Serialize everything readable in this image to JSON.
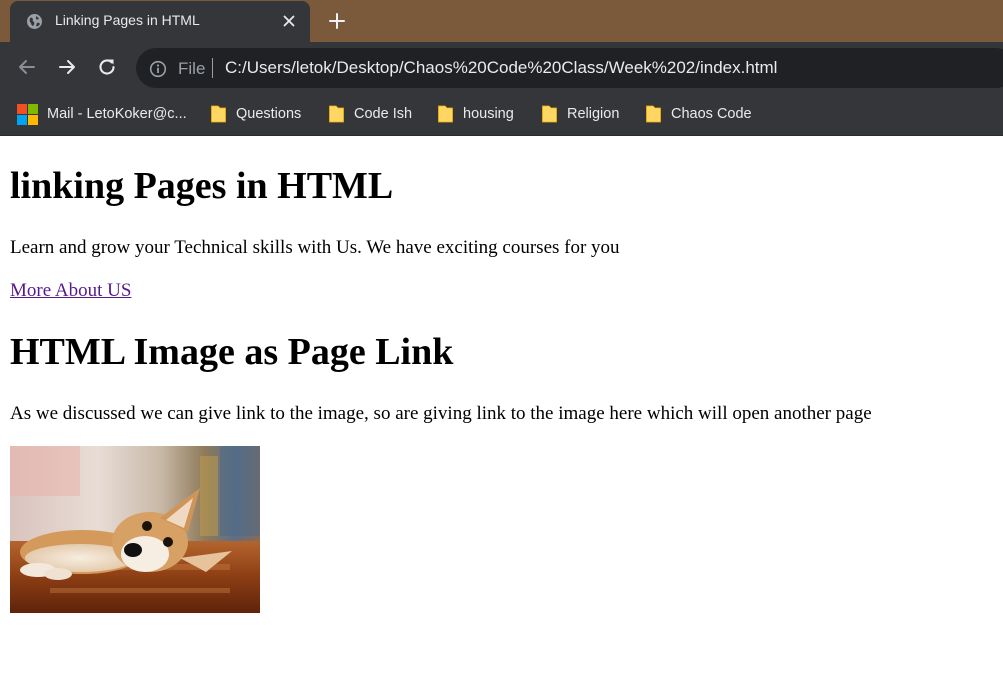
{
  "tab": {
    "title": "Linking Pages in HTML",
    "favicon": "globe-icon"
  },
  "toolbar": {
    "scheme": "File",
    "url": "C:/Users/letok/Desktop/Chaos%20Code%20Class/Week%202/index.html"
  },
  "bookmarks": [
    {
      "label": "Mail - LetoKoker@c...",
      "icon": "microsoft-icon"
    },
    {
      "label": "Questions",
      "icon": "folder-icon"
    },
    {
      "label": "Code Ish",
      "icon": "folder-icon"
    },
    {
      "label": "housing",
      "icon": "folder-icon"
    },
    {
      "label": "Religion",
      "icon": "folder-icon"
    },
    {
      "label": "Chaos Code",
      "icon": "folder-icon"
    }
  ],
  "page": {
    "heading1": "linking Pages in HTML",
    "paragraph1": "Learn and grow your Technical skills with Us. We have exciting courses for you",
    "link_text": "More About US",
    "heading2": "HTML Image as Page Link",
    "paragraph2": "As we discussed we can give link to the image, so are giving link to the image here which will open another page"
  },
  "colors": {
    "frame": "#7b5a3c",
    "chrome": "#35363a",
    "omnibox": "#202124",
    "visited_link": "#551a8b"
  }
}
